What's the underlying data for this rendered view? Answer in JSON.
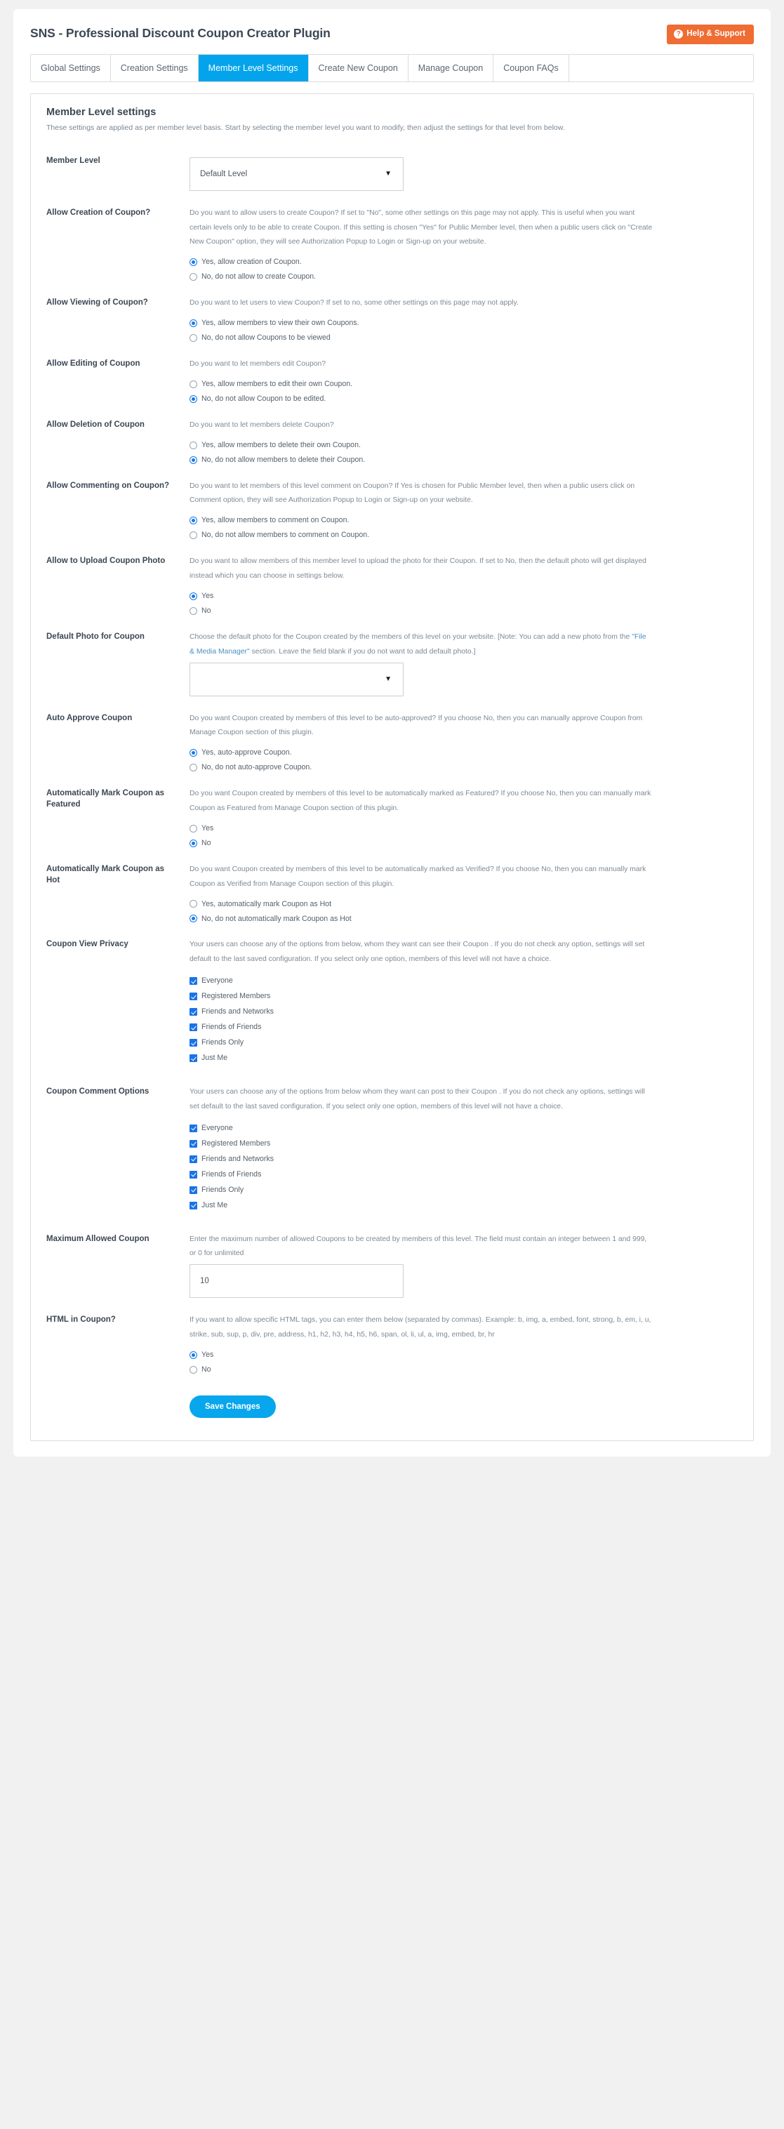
{
  "header": {
    "title": "SNS - Professional Discount Coupon Creator Plugin",
    "help_button": "Help & Support",
    "help_icon": "question-circle-icon"
  },
  "tabs": [
    {
      "label": "Global Settings",
      "active": false
    },
    {
      "label": "Creation Settings",
      "active": false
    },
    {
      "label": "Member Level Settings",
      "active": true
    },
    {
      "label": "Create New Coupon",
      "active": false
    },
    {
      "label": "Manage Coupon",
      "active": false
    },
    {
      "label": "Coupon FAQs",
      "active": false
    }
  ],
  "panel": {
    "title": "Member Level settings",
    "subtitle": "These settings are applied as per member level basis. Start by selecting the member level you want to modify, then adjust the settings for that level from below."
  },
  "fields": {
    "member_level": {
      "label": "Member Level",
      "selected": "Default Level",
      "caret": "chevron-down-icon"
    },
    "allow_creation": {
      "label": "Allow Creation of Coupon?",
      "desc": "Do you want to allow users to create Coupon? If set to \"No\", some other settings on this page may not apply. This is useful when you want certain levels only to be able to create Coupon. If this setting is chosen \"Yes\" for Public Member level, then when a public users click on \"Create New Coupon\" option, they will see Authorization Popup to Login or Sign-up on your website.",
      "options": [
        {
          "label": "Yes, allow creation of Coupon.",
          "checked": true
        },
        {
          "label": "No, do not allow to create Coupon.",
          "checked": false
        }
      ]
    },
    "allow_viewing": {
      "label": "Allow Viewing of Coupon?",
      "desc": "Do you want to let users to view Coupon? If set to no, some other settings on this page may not apply.",
      "options": [
        {
          "label": "Yes, allow members to view their own Coupons.",
          "checked": true
        },
        {
          "label": "No, do not allow Coupons to be viewed",
          "checked": false
        }
      ]
    },
    "allow_editing": {
      "label": "Allow Editing of Coupon",
      "desc": "Do you want to let members edit Coupon?",
      "options": [
        {
          "label": "Yes, allow members to edit their own Coupon.",
          "checked": false
        },
        {
          "label": "No, do not allow Coupon to be edited.",
          "checked": true
        }
      ]
    },
    "allow_deletion": {
      "label": "Allow Deletion of Coupon",
      "desc": "Do you want to let members delete Coupon?",
      "options": [
        {
          "label": "Yes, allow members to delete their own Coupon.",
          "checked": false
        },
        {
          "label": "No, do not allow members to delete their Coupon.",
          "checked": true
        }
      ]
    },
    "allow_commenting": {
      "label": "Allow Commenting on Coupon?",
      "desc": "Do you want to let members of this level comment on Coupon? If Yes is chosen for Public Member level, then when a public users click on Comment option, they will see Authorization Popup to Login or Sign-up on your website.",
      "options": [
        {
          "label": "Yes, allow members to comment on Coupon.",
          "checked": true
        },
        {
          "label": "No, do not allow members to comment on Coupon.",
          "checked": false
        }
      ]
    },
    "allow_upload_photo": {
      "label": "Allow to Upload Coupon Photo",
      "desc": "Do you want to allow members of this member level to upload the photo for their Coupon. If set to No, then the default photo will get displayed instead which you can choose in settings below.",
      "options": [
        {
          "label": "Yes",
          "checked": true
        },
        {
          "label": "No",
          "checked": false
        }
      ]
    },
    "default_photo": {
      "label": "Default Photo for Coupon",
      "desc_before": "Choose the default photo for the Coupon created by the members of this level on your website. [Note: You can add a new photo from the ",
      "link_text": "\"File & Media Manager\"",
      "desc_after": " section. Leave the field blank if you do not want to add default photo.]",
      "selected": "",
      "caret": "chevron-down-icon"
    },
    "auto_approve": {
      "label": "Auto Approve Coupon",
      "desc": "Do you want Coupon created by members of this level to be auto-approved? If you choose No, then you can manually approve Coupon from Manage Coupon section of this plugin.",
      "options": [
        {
          "label": "Yes, auto-approve Coupon.",
          "checked": true
        },
        {
          "label": "No, do not auto-approve Coupon.",
          "checked": false
        }
      ]
    },
    "mark_featured": {
      "label": "Automatically Mark Coupon as Featured",
      "desc": "Do you want Coupon created by members of this level to be automatically marked as Featured? If you choose No, then you can manually mark Coupon as Featured from Manage Coupon section of this plugin.",
      "options": [
        {
          "label": "Yes",
          "checked": false
        },
        {
          "label": "No",
          "checked": true
        }
      ]
    },
    "mark_hot": {
      "label": "Automatically Mark Coupon as Hot",
      "desc": "Do you want Coupon created by members of this level to be automatically marked as Verified? If you choose No, then you can manually mark Coupon as Verified from Manage Coupon section of this plugin.",
      "options": [
        {
          "label": "Yes, automatically mark Coupon as Hot",
          "checked": false
        },
        {
          "label": "No, do not automatically mark Coupon as Hot",
          "checked": true
        }
      ]
    },
    "view_privacy": {
      "label": "Coupon View Privacy",
      "desc": "Your users can choose any of the options from below, whom they want can see their Coupon . If you do not check any option, settings will set default to the last saved configuration. If you select only one option, members of this level will not have a choice.",
      "options": [
        {
          "label": "Everyone",
          "checked": true
        },
        {
          "label": "Registered Members",
          "checked": true
        },
        {
          "label": "Friends and Networks",
          "checked": true
        },
        {
          "label": "Friends of Friends",
          "checked": true
        },
        {
          "label": "Friends Only",
          "checked": true
        },
        {
          "label": "Just Me",
          "checked": true
        }
      ]
    },
    "comment_options": {
      "label": "Coupon Comment Options",
      "desc": "Your users can choose any of the options from below whom they want can post to their Coupon . If you do not check any options, settings will set default to the last saved configuration. If you select only one option, members of this level will not have a choice.",
      "options": [
        {
          "label": "Everyone",
          "checked": true
        },
        {
          "label": "Registered Members",
          "checked": true
        },
        {
          "label": "Friends and Networks",
          "checked": true
        },
        {
          "label": "Friends of Friends",
          "checked": true
        },
        {
          "label": "Friends Only",
          "checked": true
        },
        {
          "label": "Just Me",
          "checked": true
        }
      ]
    },
    "max_allowed": {
      "label": "Maximum Allowed Coupon",
      "desc": "Enter the maximum number of allowed Coupons to be created by members of this level. The field must contain an integer between 1 and 999, or 0 for unlimited",
      "value": "10",
      "placeholder": ""
    },
    "html_in_coupon": {
      "label": "HTML in Coupon?",
      "desc": "If you want to allow specific HTML tags, you can enter them below (separated by commas). Example: b, img, a, embed, font, strong, b, em, i, u, strike, sub, sup, p, div, pre, address, h1, h2, h3, h4, h5, h6, span, ol, li, ul, a, img, embed, br, hr",
      "options": [
        {
          "label": "Yes",
          "checked": true
        },
        {
          "label": "No",
          "checked": false
        }
      ]
    }
  },
  "footer": {
    "save_label": "Save Changes"
  },
  "colors": {
    "accent_blue": "#04a4ec",
    "help_orange": "#ef6c32",
    "checkbox_blue": "#1a73e8",
    "radio_blue": "#1779e4",
    "link_blue": "#4a90c4"
  }
}
